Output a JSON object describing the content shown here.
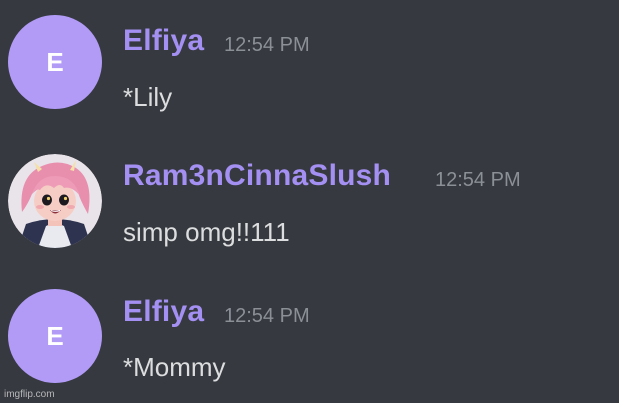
{
  "messages": [
    {
      "username": "Elfiya",
      "timestamp": "12:54 PM",
      "avatar_letter": "E",
      "text": "*Lily"
    },
    {
      "username": "Ram3nCinnaSlush",
      "timestamp": "12:54 PM",
      "avatar_letter": "",
      "text": "simp omg!!111"
    },
    {
      "username": "Elfiya",
      "timestamp": "12:54 PM",
      "avatar_letter": "E",
      "text": "*Mommy"
    }
  ],
  "watermark": "imgflip.com",
  "colors": {
    "background": "#36393f",
    "username": "#a48ff2",
    "timestamp": "#8b8f96",
    "message_text": "#dcddde",
    "avatar_default": "#b19bf7"
  },
  "icons": {
    "avatar_photo": "anime-character-avatar-icon"
  }
}
